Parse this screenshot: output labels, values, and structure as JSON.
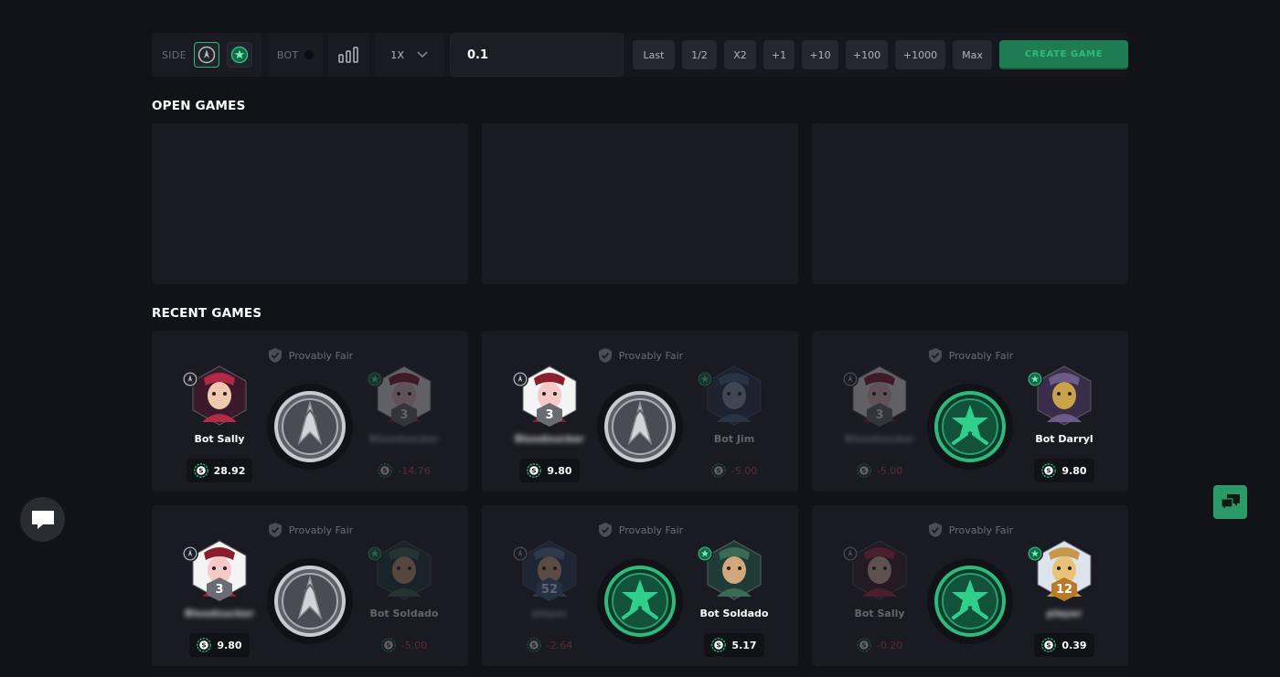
{
  "toolbar": {
    "side_label": "SIDE",
    "bot_label": "BOT",
    "multiplier": "1X",
    "bet_value": "0.1",
    "quick_buttons": [
      "Last",
      "1/2",
      "X2",
      "+1",
      "+10",
      "+100",
      "+1000",
      "Max"
    ],
    "create_label": "CREATE GAME"
  },
  "sections": {
    "open_title": "OPEN GAMES",
    "recent_title": "RECENT GAMES"
  },
  "recent": {
    "fair_label": "Provably Fair",
    "games": [
      {
        "left": {
          "name": "Bot Sally",
          "amount": "28.92",
          "side": "t",
          "level": "",
          "winner": true,
          "avatar": "sally"
        },
        "right": {
          "name": "Bloodsucker",
          "amount": "-14.76",
          "side": "ct",
          "level": "3",
          "winner": false,
          "avatar": "pig"
        },
        "coin": "t"
      },
      {
        "left": {
          "name": "Bloodsucker",
          "amount": "9.80",
          "side": "t",
          "level": "3",
          "winner": true,
          "avatar": "pig"
        },
        "right": {
          "name": "Bot Jim",
          "amount": "-5.00",
          "side": "ct",
          "level": "",
          "winner": false,
          "avatar": "jim"
        },
        "coin": "t"
      },
      {
        "left": {
          "name": "Bloodsucker",
          "amount": "-5.00",
          "side": "t",
          "level": "3",
          "winner": false,
          "avatar": "pig"
        },
        "right": {
          "name": "Bot Darryl",
          "amount": "9.80",
          "side": "ct",
          "level": "",
          "winner": true,
          "avatar": "darryl"
        },
        "coin": "ct"
      },
      {
        "left": {
          "name": "Bloodsucker",
          "amount": "9.80",
          "side": "t",
          "level": "3",
          "winner": true,
          "avatar": "pig"
        },
        "right": {
          "name": "Bot Soldado",
          "amount": "-5.00",
          "side": "ct",
          "level": "",
          "winner": false,
          "avatar": "soldado"
        },
        "coin": "t"
      },
      {
        "left": {
          "name": "player",
          "amount": "-2.64",
          "side": "t",
          "level": "52",
          "winner": false,
          "avatar": "man"
        },
        "right": {
          "name": "Bot Soldado",
          "amount": "5.17",
          "side": "ct",
          "level": "",
          "winner": true,
          "avatar": "soldado"
        },
        "coin": "ct"
      },
      {
        "left": {
          "name": "Bot Sally",
          "amount": "-0.20",
          "side": "t",
          "level": "",
          "winner": false,
          "avatar": "sally"
        },
        "right": {
          "name": "player",
          "amount": "0.39",
          "side": "ct",
          "level": "12",
          "winner": true,
          "avatar": "doge"
        },
        "coin": "ct"
      }
    ]
  },
  "colors": {
    "bg": "#121318",
    "card": "#191a22",
    "accent": "#2fb97a",
    "negative": "#e0525d"
  },
  "icons": {
    "t_side": "terrorist-icon",
    "ct_side": "counter-terrorist-icon",
    "coin": "coin-icon",
    "shield": "shield-check-icon",
    "chat": "chat-bubble-icon",
    "support": "support-chat-icon"
  }
}
